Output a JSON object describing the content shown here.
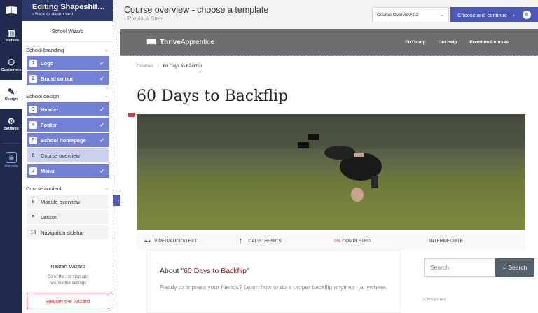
{
  "rail": {
    "items": [
      {
        "label": "Courses",
        "icon": "courses-icon"
      },
      {
        "label": "Customers",
        "icon": "customers-icon"
      },
      {
        "label": "Design",
        "icon": "brush-icon"
      },
      {
        "label": "Settings",
        "icon": "gear-icon"
      }
    ],
    "preview_label": "Preview"
  },
  "wizard": {
    "title": "Editing Shapeshift L...",
    "back": "Back to dashboard",
    "subtitle": "School Wizard",
    "sections": [
      {
        "title": "School branding",
        "steps": [
          {
            "num": "1",
            "label": "Logo",
            "state": "done"
          },
          {
            "num": "2",
            "label": "Brand colour",
            "state": "done"
          }
        ]
      },
      {
        "title": "School design",
        "steps": [
          {
            "num": "3",
            "label": "Header",
            "state": "done"
          },
          {
            "num": "4",
            "label": "Footer",
            "state": "done"
          },
          {
            "num": "5",
            "label": "School homepage",
            "state": "done"
          },
          {
            "num": "6",
            "label": "Course overview",
            "state": "current"
          },
          {
            "num": "7",
            "label": "Menu",
            "state": "done"
          }
        ]
      },
      {
        "title": "Course content",
        "steps": [
          {
            "num": "8",
            "label": "Module overview",
            "state": "todo"
          },
          {
            "num": "9",
            "label": "Lesson",
            "state": "todo"
          },
          {
            "num": "10",
            "label": "Navigation sidebar",
            "state": "todo"
          }
        ]
      }
    ],
    "restart": {
      "heading": "Restart Wizard",
      "text_line1": "Go to the 1st step and",
      "text_line2": "resume the settings",
      "button": "Restart the Wizard"
    }
  },
  "topbar": {
    "title": "Course overview - choose a template",
    "prev": "Previous Step",
    "template_select": "Course Overview 02",
    "continue": "Choose and continue",
    "badge": "8"
  },
  "site": {
    "brand_bold": "Thrive",
    "brand_light": " Apprentice",
    "nav": [
      "Fb Group",
      "Get Help",
      "Premium Courses"
    ],
    "crumb_root": "Courses",
    "crumb_sep": "/",
    "crumb_current": "60 Days to Backflip",
    "course_title": "60 Days to Backflip",
    "meta": {
      "type": "VIDEO/AUDIO/TEXT",
      "topic": "CALISTHENICS",
      "progress": "0%",
      "progress_label": " COMPLETED",
      "level": "INTERMEDIATE"
    },
    "about_prefix": "About \"",
    "about_course": "60 Days to Backflip",
    "about_suffix": "\"",
    "about_text": "Ready to impress your friends? Learn how to do a proper backflip anytime - anywhere.",
    "search_placeholder": "Search",
    "search_button": "Search",
    "categories": "Categories"
  },
  "colors": {
    "rail": "#1f2a4d",
    "accent": "#4b57b9",
    "step_done": "#7280d6",
    "step_current": "#cdd3ef",
    "restart": "#d83b3b",
    "site_nav": "#6d6e70",
    "about_highlight": "#a01f2e"
  }
}
